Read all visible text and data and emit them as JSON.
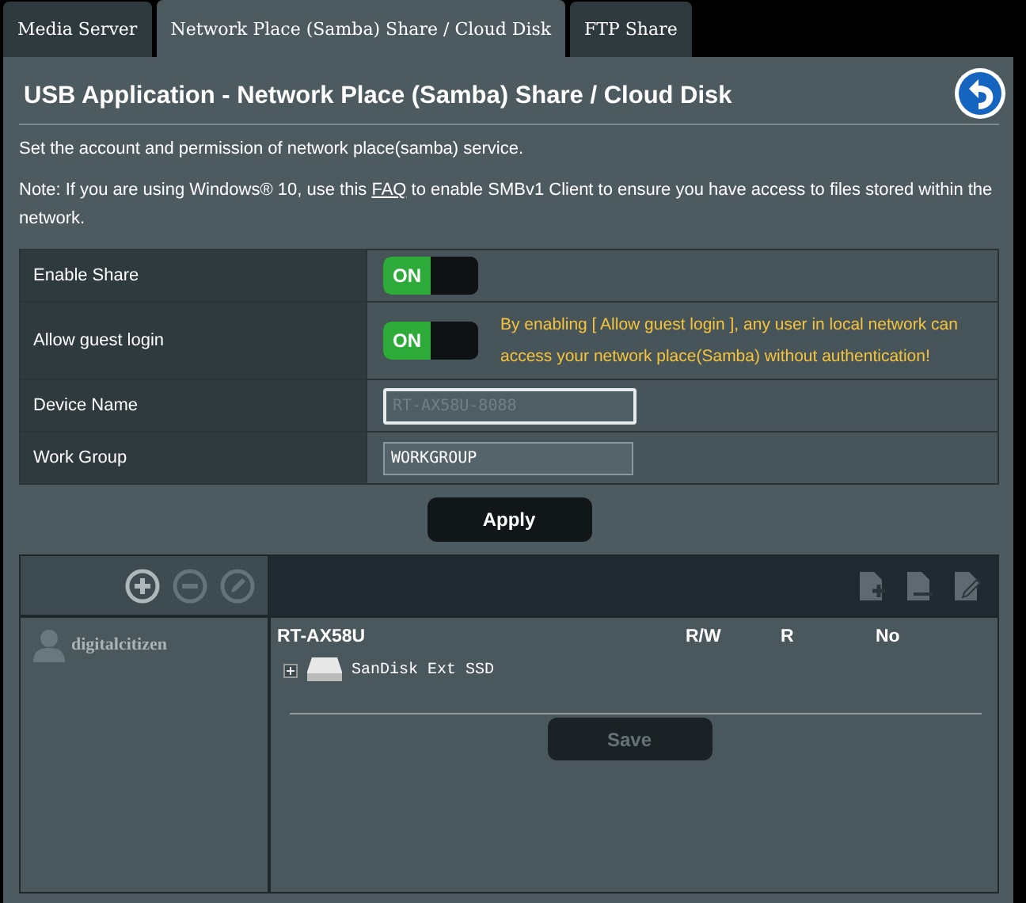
{
  "tabs": [
    {
      "label": "Media Server",
      "selected": false
    },
    {
      "label": "Network Place (Samba) Share / Cloud Disk",
      "selected": true
    },
    {
      "label": "FTP Share",
      "selected": false
    }
  ],
  "title": "USB Application - Network Place (Samba) Share / Cloud Disk",
  "description": "Set the account and permission of network place(samba) service.",
  "note": {
    "before": "Note: If you are using Windows® 10, use this",
    "link": "FAQ",
    "after": "to enable SMBv1 Client to ensure you have access to files stored within the network."
  },
  "settings": [
    {
      "kind": "toggle",
      "label": "Enable Share",
      "on": true,
      "toggle_label": "ON"
    },
    {
      "kind": "toggle",
      "label": "Allow guest login",
      "on": true,
      "toggle_label": "ON",
      "warning": "By enabling [ Allow guest login ], any user in local network can access your network place(Samba) without authentication!"
    },
    {
      "kind": "input",
      "label": "Device Name",
      "placeholder": "RT-AX58U-8088"
    },
    {
      "kind": "input",
      "label": "Work Group",
      "value": "WORKGROUP"
    }
  ],
  "apply_button": "Apply",
  "account_tools": [
    {
      "kind": "add",
      "disabled": false
    },
    {
      "kind": "remove",
      "disabled": true
    },
    {
      "kind": "edit",
      "disabled": true
    }
  ],
  "users": [
    {
      "name": "digitalcitizen"
    }
  ],
  "device": {
    "name": "RT-AX58U",
    "permissions": [
      "R/W",
      "R",
      "No"
    ]
  },
  "folders": [
    {
      "name": "SanDisk Ext SSD",
      "expanded": false
    }
  ],
  "save_button": {
    "label": "Save",
    "disabled": true
  }
}
